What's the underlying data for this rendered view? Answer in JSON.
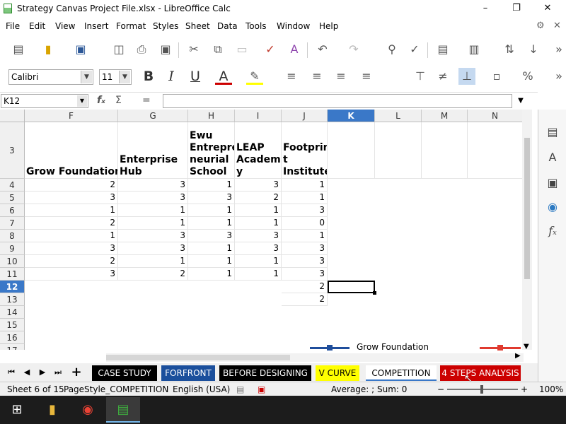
{
  "window": {
    "title": "Strategy Canvas Project File.xlsx - LibreOffice Calc"
  },
  "menu": [
    "File",
    "Edit",
    "View",
    "Insert",
    "Format",
    "Styles",
    "Sheet",
    "Data",
    "Tools",
    "Window",
    "Help"
  ],
  "formatting": {
    "font_name": "Calibri",
    "font_size": "11"
  },
  "formula_bar": {
    "cell_ref": "K12",
    "content": ""
  },
  "columns": [
    "F",
    "G",
    "H",
    "I",
    "J",
    "K",
    "L",
    "M",
    "N"
  ],
  "active_column": "K",
  "rows": [
    "3",
    "4",
    "5",
    "6",
    "7",
    "8",
    "9",
    "10",
    "11",
    "12",
    "13",
    "14",
    "15",
    "16",
    "17"
  ],
  "active_row": "12",
  "headers": [
    "Grow Foundation",
    "Enterprise Hub",
    "Ewu Entrepreneurial School",
    "LEAP Academy",
    "Footprint Institute"
  ],
  "header_display": [
    "Grow Foundation",
    "Enterprise\nHub",
    "Ewu\nEntrepre\nneurial\nSchool",
    "LEAP\nAcadem\ny",
    "Footprin\nt\nInstitute"
  ],
  "data_rows": [
    [
      2,
      3,
      1,
      3,
      1
    ],
    [
      3,
      3,
      3,
      2,
      1
    ],
    [
      1,
      1,
      1,
      1,
      3
    ],
    [
      2,
      1,
      1,
      1,
      0
    ],
    [
      1,
      3,
      3,
      3,
      1
    ],
    [
      3,
      3,
      1,
      3,
      3
    ],
    [
      2,
      1,
      1,
      1,
      3
    ],
    [
      3,
      2,
      1,
      1,
      3
    ]
  ],
  "extra_j_values": {
    "12": 2,
    "13": 2
  },
  "legend": [
    {
      "name": "Grow Foundation",
      "color": "#1f4e9c"
    },
    {
      "name": "",
      "color": "#e03a2f"
    }
  ],
  "sheet_tabs": [
    {
      "label": "CASE STUDY",
      "bg": "#000000",
      "color": "#ffffff"
    },
    {
      "label": "FORFRONT",
      "bg": "#1b4f9c",
      "color": "#ffffff"
    },
    {
      "label": "BEFORE DESIGNING",
      "bg": "#000000",
      "color": "#ffffff"
    },
    {
      "label": "V CURVE",
      "bg": "#ffff00",
      "color": "#000000"
    },
    {
      "label": "COMPETITION",
      "bg": "#ffffff",
      "color": "#000000",
      "active": true
    },
    {
      "label": "4 STEPS ANALYSIS",
      "bg": "#cc0000",
      "color": "#ffffff"
    }
  ],
  "status": {
    "sheet": "Sheet 6 of 15",
    "page_style": "PageStyle_COMPETITION",
    "language": "English (USA)",
    "summary": "Average: ; Sum: 0",
    "zoom": "100%"
  }
}
